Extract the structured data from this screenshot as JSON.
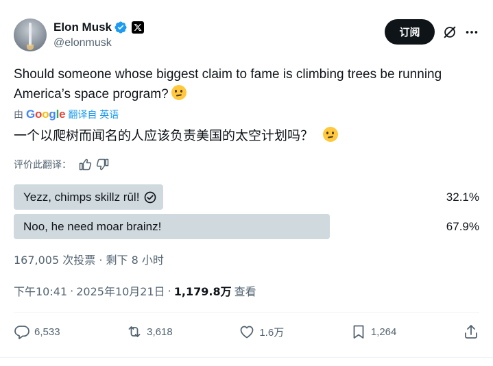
{
  "author": {
    "display_name": "Elon Musk",
    "handle": "@elonmusk"
  },
  "header": {
    "subscribe_label": "订阅"
  },
  "tweet": {
    "text": "Should someone whose biggest claim to fame is climbing trees be running America’s space program?",
    "emoji": "thinking-face"
  },
  "translation": {
    "by_prefix": "由",
    "provider": "Google",
    "from_label": "翻译自 英语",
    "text": "一个以爬树而闻名的人应该负责美国的太空计划吗？",
    "rate_label": "评价此翻译："
  },
  "poll": {
    "options": [
      {
        "label": "Yezz, chimps skillz rūl!",
        "percent": "32.1%",
        "fraction": 0.321,
        "winner": false,
        "voted": true
      },
      {
        "label": "Noo, he need moar brainz!",
        "percent": "67.9%",
        "fraction": 0.679,
        "winner": true,
        "voted": false
      }
    ],
    "meta": "167,005 次投票 · 剩下 8 小时"
  },
  "timestamp": {
    "time": "下午10:41",
    "date": "2025年10月21日",
    "views_count": "1,179.8万",
    "views_label": "查看"
  },
  "actions": {
    "replies": "6,533",
    "reposts": "3,618",
    "likes": "1.6万",
    "bookmarks": "1,264"
  },
  "colors": {
    "text": "#0f1419",
    "secondary": "#536471",
    "link": "#1d9bf0",
    "verified": "#1d9bf0",
    "poll_bar": "#cfd9de"
  }
}
